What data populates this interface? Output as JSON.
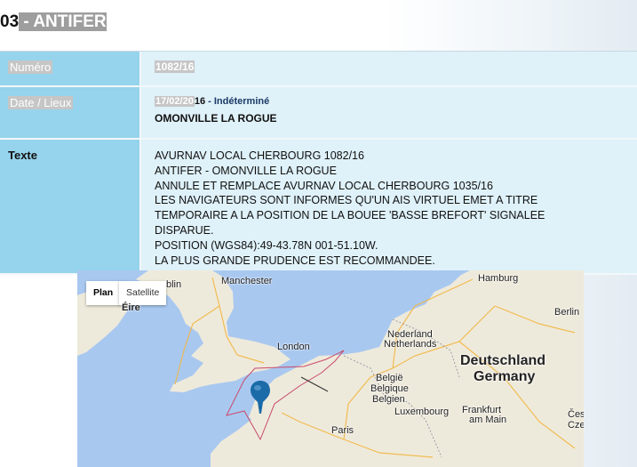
{
  "title": {
    "number": "03",
    "name": " - ANTIFER"
  },
  "rows": {
    "numero": {
      "label": "Numéro",
      "value": "1082/16"
    },
    "date": {
      "label": "Date / Lieux",
      "date_hl": "17/02/20",
      "date_rest": "16",
      "separator": " - ",
      "status": "Indéterminé",
      "place": "OMONVILLE LA ROGUE"
    },
    "texte": {
      "label": "Texte",
      "lines": [
        "AVURNAV LOCAL CHERBOURG 1082/16",
        "ANTIFER - OMONVILLE LA ROGUE",
        "ANNULE ET REMPLACE AVURNAV LOCAL CHERBOURG 1035/16",
        "LES NAVIGATEURS SONT INFORMES QU'UN AIS VIRTUEL EMET A TITRE",
        "TEMPORAIRE A LA POSITION DE LA BOUEE 'BASSE BREFORT' SIGNALEE",
        "DISPARUE.",
        "POSITION (WGS84):49-43.78N 001-51.10W.",
        "LA PLUS GRANDE PRUDENCE EST RECOMMANDEE."
      ]
    }
  },
  "map": {
    "plan_label": "Plan",
    "satellite_label": "Satellite",
    "marker_icon": "map-pin-icon",
    "cities": {
      "dublin": "blin",
      "eire": "Éire",
      "manchester": "Manchester",
      "london": "London",
      "hamburg": "Hamburg",
      "berlin": "Berlin",
      "nederland": "Nederland",
      "netherlands": "Netherlands",
      "belgie": "België",
      "belgique": "Belgique",
      "belgien": "Belgien",
      "luxembourg": "Luxembourg",
      "frankfurt": "Frankfurt",
      "am_main": "am Main",
      "paris": "Paris",
      "cesk": "Česk",
      "cze": "Cze"
    },
    "countries": {
      "deutschland": "Deutschland",
      "germany": "Germany"
    },
    "colors": {
      "sea": "#a9c8f0",
      "land": "#eeeadb",
      "marker": "#1b6ba8",
      "zone": "#c84a6a"
    }
  }
}
